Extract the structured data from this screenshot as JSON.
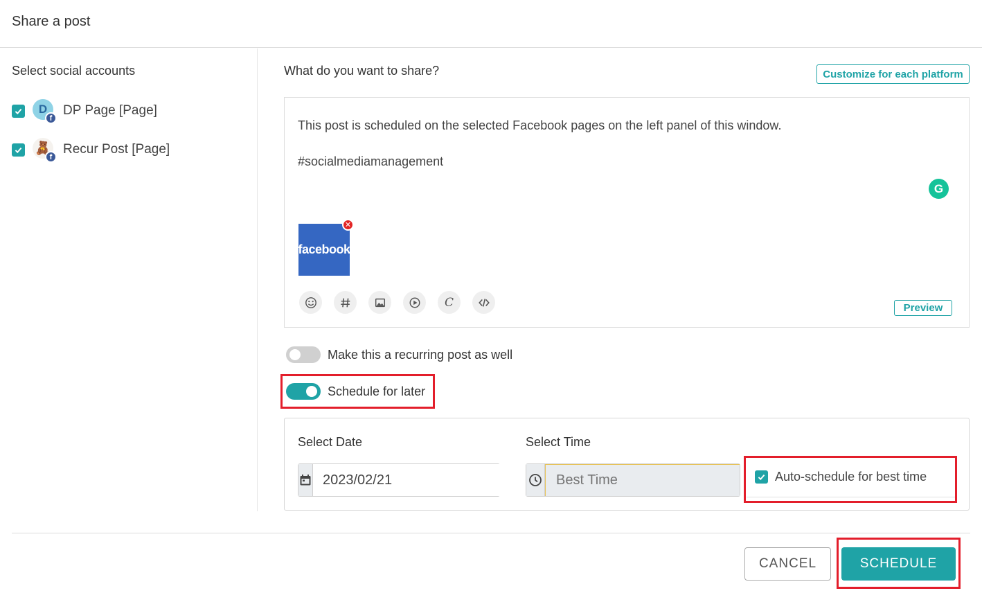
{
  "dialog": {
    "title": "Share a post"
  },
  "accounts_panel": {
    "heading": "Select social accounts",
    "accounts": [
      {
        "name": "DP Page [Page]",
        "avatar_letter": "D",
        "checked": true
      },
      {
        "name": "Recur Post [Page]",
        "avatar_letter": "🧸",
        "checked": true
      }
    ],
    "badge": "f"
  },
  "composer": {
    "heading": "What do you want to share?",
    "customize_label": "Customize for each platform",
    "text_line1": "This post is scheduled on the selected Facebook pages on the left panel of this window.",
    "text_line2": "#socialmediamanagement",
    "attachment_label": "facebook",
    "grammarly_letter": "G",
    "tools": [
      "emoji-icon",
      "hashtag-icon",
      "image-icon",
      "video-icon",
      "canva-icon",
      "code-icon"
    ],
    "preview_label": "Preview"
  },
  "options": {
    "recurring_label": "Make this a recurring post as well",
    "recurring_on": false,
    "schedule_label": "Schedule for later",
    "schedule_on": true
  },
  "schedule": {
    "date_label": "Select Date",
    "date_value": "2023/02/21",
    "time_label": "Select Time",
    "time_placeholder": "Best Time",
    "auto_label": "Auto-schedule for best time",
    "auto_checked": true
  },
  "footer": {
    "cancel_label": "CANCEL",
    "schedule_label": "SCHEDULE"
  },
  "colors": {
    "accent": "#1fa3a6",
    "highlight": "#e31e2b",
    "facebook": "#3b5998"
  }
}
